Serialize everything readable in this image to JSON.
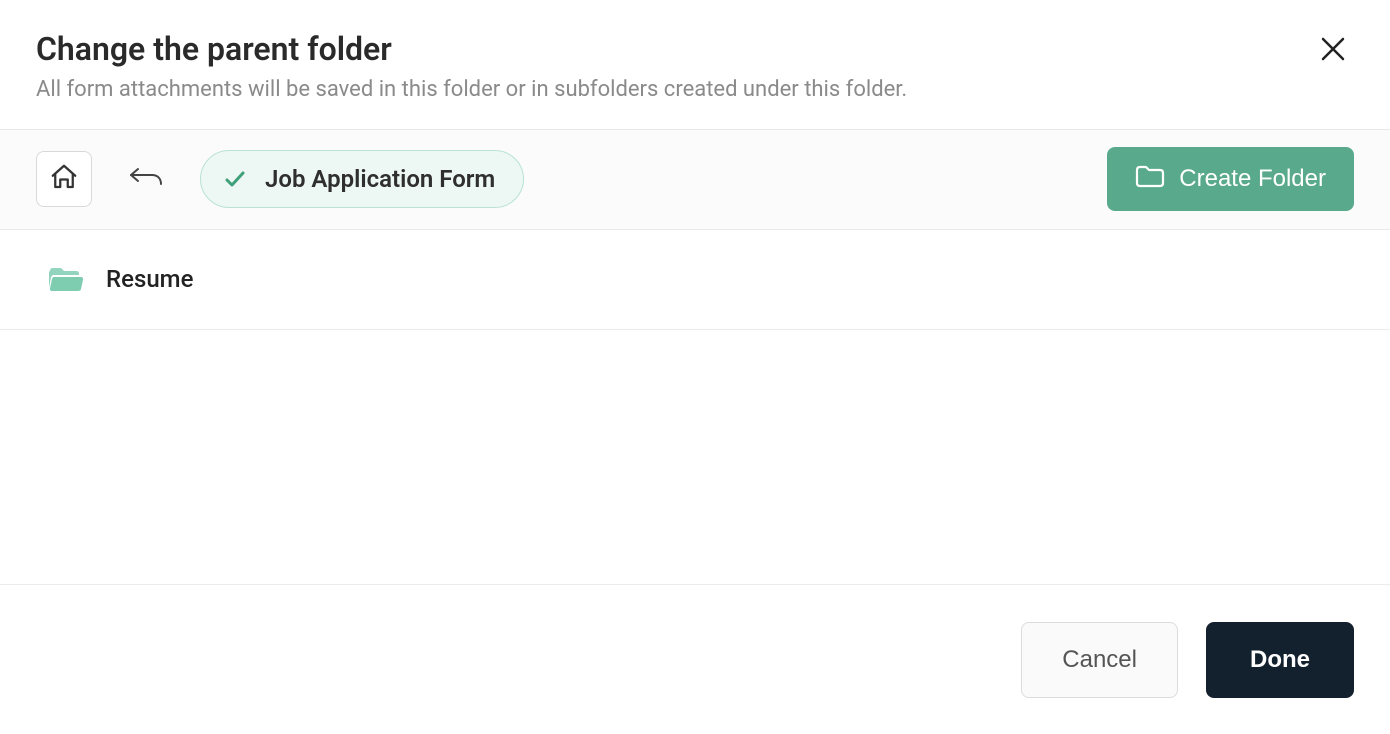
{
  "header": {
    "title": "Change the parent folder",
    "subtitle": "All form attachments will be saved in this folder or in subfolders created under this folder."
  },
  "toolbar": {
    "current_folder": "Job Application Form",
    "create_folder_label": "Create Folder"
  },
  "list": {
    "items": [
      {
        "name": "Resume"
      }
    ]
  },
  "footer": {
    "cancel_label": "Cancel",
    "done_label": "Done"
  }
}
